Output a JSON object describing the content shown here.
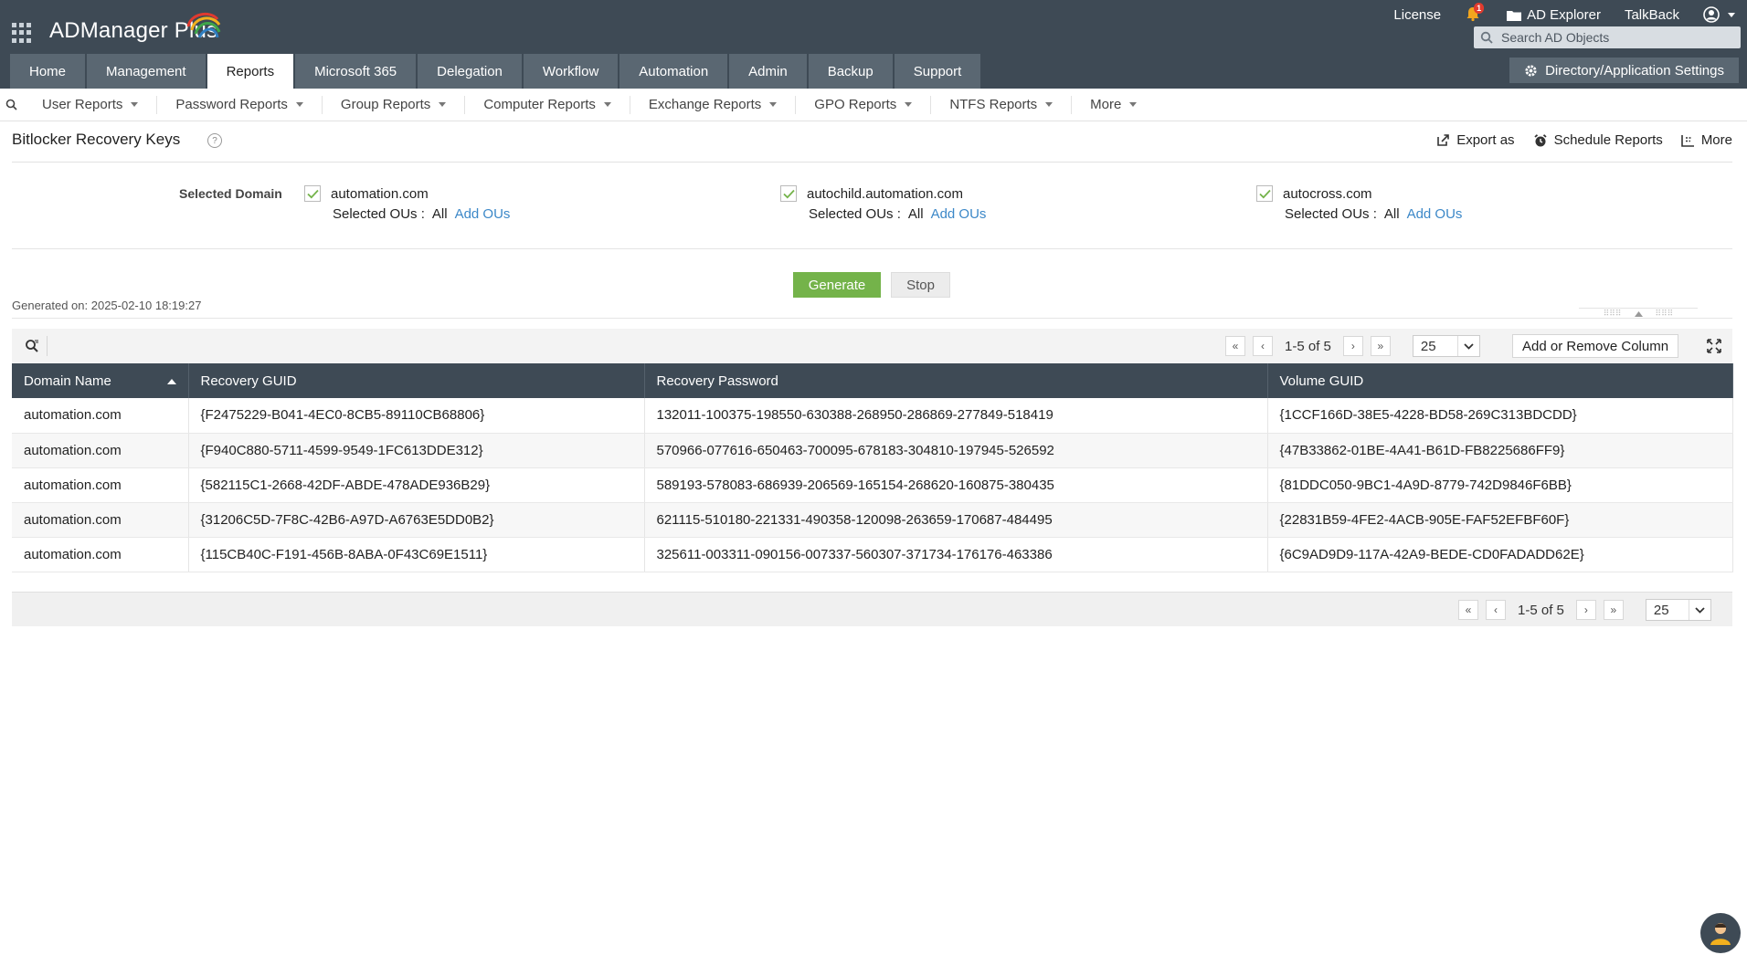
{
  "app": {
    "name": "ADManager Plus"
  },
  "top_links": {
    "license": "License",
    "notif_count": "1",
    "ad_explorer": "AD Explorer",
    "talkback": "TalkBack"
  },
  "search": {
    "placeholder": "Search AD Objects"
  },
  "main_tabs": [
    {
      "label": "Home"
    },
    {
      "label": "Management"
    },
    {
      "label": "Reports",
      "active": true
    },
    {
      "label": "Microsoft 365"
    },
    {
      "label": "Delegation"
    },
    {
      "label": "Workflow"
    },
    {
      "label": "Automation"
    },
    {
      "label": "Admin"
    },
    {
      "label": "Backup"
    },
    {
      "label": "Support"
    }
  ],
  "dir_settings": "Directory/Application Settings",
  "subnav": [
    {
      "label": "User Reports"
    },
    {
      "label": "Password Reports"
    },
    {
      "label": "Group Reports"
    },
    {
      "label": "Computer Reports"
    },
    {
      "label": "Exchange Reports"
    },
    {
      "label": "GPO Reports"
    },
    {
      "label": "NTFS Reports"
    },
    {
      "label": "More"
    }
  ],
  "report": {
    "title": "Bitlocker Recovery Keys",
    "help": "?",
    "actions": {
      "export": "Export as",
      "schedule": "Schedule Reports",
      "more": "More"
    },
    "selected_domain_label": "Selected Domain",
    "domains": [
      {
        "name": "automation.com",
        "ou_label": "Selected OUs :",
        "ou_value": "All",
        "add_ous": "Add OUs",
        "checked": true
      },
      {
        "name": "autochild.automation.com",
        "ou_label": "Selected OUs :",
        "ou_value": "All",
        "add_ous": "Add OUs",
        "checked": true
      },
      {
        "name": "autocross.com",
        "ou_label": "Selected OUs :",
        "ou_value": "All",
        "add_ous": "Add OUs",
        "checked": true
      }
    ],
    "generate": "Generate",
    "stop": "Stop",
    "generated_on": "Generated on: 2025-02-10 18:19:27"
  },
  "grid": {
    "pager_text": "1-5 of 5",
    "page_size": "25",
    "add_remove_column": "Add or Remove Column",
    "columns": [
      "Domain Name",
      "Recovery GUID",
      "Recovery Password",
      "Volume GUID"
    ],
    "rows": [
      [
        "automation.com",
        "{F2475229-B041-4EC0-8CB5-89110CB68806}",
        "132011-100375-198550-630388-268950-286869-277849-518419",
        "{1CCF166D-38E5-4228-BD58-269C313BDCDD}"
      ],
      [
        "automation.com",
        "{F940C880-5711-4599-9549-1FC613DDE312}",
        "570966-077616-650463-700095-678183-304810-197945-526592",
        "{47B33862-01BE-4A41-B61D-FB8225686FF9}"
      ],
      [
        "automation.com",
        "{582115C1-2668-42DF-ABDE-478ADE936B29}",
        "589193-578083-686939-206569-165154-268620-160875-380435",
        "{81DDC050-9BC1-4A9D-8779-742D9846F6BB}"
      ],
      [
        "automation.com",
        "{31206C5D-7F8C-42B6-A97D-A6763E5DD0B2}",
        "621115-510180-221331-490358-120098-263659-170687-484495",
        "{22831B59-4FE2-4ACB-905E-FAF52EFBF60F}"
      ],
      [
        "automation.com",
        "{115CB40C-F191-456B-8ABA-0F43C69E1511}",
        "325611-003311-090156-007337-560307-371734-176176-463386",
        "{6C9AD9D9-117A-42A9-BEDE-CD0FADADD62E}"
      ]
    ]
  },
  "colors": {
    "header_bg": "#3e4a55",
    "tab_bg": "#5a6772",
    "generate_green": "#74b34a",
    "link_blue": "#3c88c8",
    "badge_red": "#e23b2e"
  }
}
